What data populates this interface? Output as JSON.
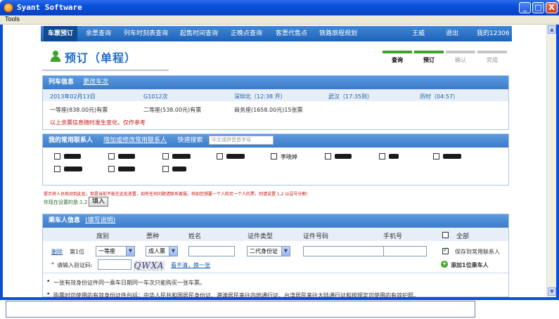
{
  "window": {
    "title": "Syant Software",
    "controls": [
      "_",
      "□",
      "X"
    ],
    "menu": [
      "Tools"
    ]
  },
  "nav": {
    "items": [
      "车票预订",
      "余票查询",
      "列车时刻表查询",
      "起售时间查询",
      "正晚点查询",
      "客票代售点",
      "铁路旅程规划"
    ],
    "user": "王威",
    "logout": "退出",
    "my12306": "我的12306"
  },
  "booking": {
    "title": "预订（单程）",
    "steps": [
      "查询",
      "预订",
      "确认",
      "完成"
    ]
  },
  "train_info": {
    "header": "列车信息",
    "change_link": "更改车次",
    "date": "2013年02月13日",
    "train": "G1012次",
    "from": "深圳北（12:38 开）",
    "to": "武汉（17:35到）",
    "duration": "历时（04:57）",
    "seat1": "一等座(838.00元)有票",
    "seat2": "二等座(538.00元)有票",
    "seat3": "商务座(1658.00元)15张票",
    "note": "以上余票信息随时发生变化，仅作参考"
  },
  "contacts": {
    "header": "我的常用联系人",
    "add_link": "增加或修改常用联系人",
    "quick_search": "快速搜索",
    "search_placeholder": "中文或拼音首字母",
    "visible_name": "李晓婷"
  },
  "hints": {
    "line1": "提示将人员拖动到此处，但是当前不能在此处放置，如有任何问题请联系客服，例如您想要一个人和另一个人的票，则请设置 1,2 以逗号分割!",
    "line2_prefix": "你现在设置的是:",
    "line2_value": "1,2",
    "fill_button": "填入"
  },
  "passengers": {
    "header": "乘车人信息",
    "fill_link": "(填写说明)",
    "columns": [
      "席别",
      "票种",
      "姓名",
      "证件类型",
      "证件号码",
      "手机号",
      "全部"
    ],
    "row": {
      "delete": "删除",
      "index": "第1位",
      "seat": "一等座",
      "ticket": "成人票",
      "id_type": "二代身份证",
      "save_label": "保存到常用联系人"
    },
    "captcha_label": "请输入验证码:",
    "captcha_text": "QWXA",
    "refresh_link": "看不清，换一张",
    "add_passenger": "添加1位乘车人"
  },
  "notes": {
    "n1": "一张有效身份证件同一乘车日期同一车次只能购买一张车票。",
    "n2": "购票时可使用的有效身份证件包括：中华人民共和国居民身份证、港澳居民来往内地通行证、台湾居民来往大陆通行证和按规定可使用的有效护照。"
  }
}
